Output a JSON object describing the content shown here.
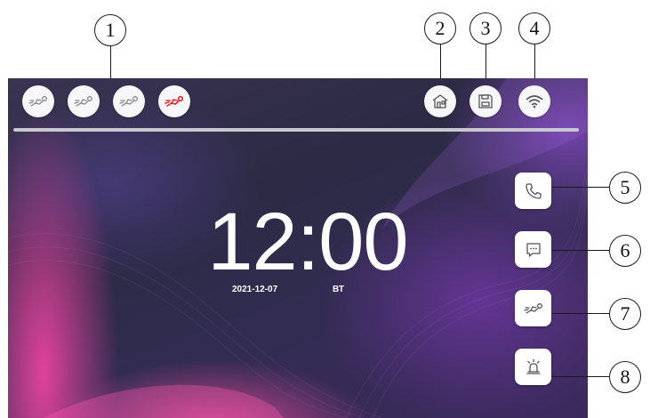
{
  "callouts": [
    "1",
    "2",
    "3",
    "4",
    "5",
    "6",
    "7",
    "8"
  ],
  "clock": {
    "time": "12:00",
    "date": "2021-12-07",
    "day": "ВТ"
  },
  "status_icons": [
    {
      "name": "intruder-icon",
      "state": "inactive",
      "color": "#888888"
    },
    {
      "name": "intruder-icon",
      "state": "inactive",
      "color": "#888888"
    },
    {
      "name": "intruder-icon",
      "state": "inactive",
      "color": "#888888"
    },
    {
      "name": "intruder-icon",
      "state": "alarm",
      "color": "#e3282e"
    }
  ],
  "top_right_icons": [
    "home-icon",
    "floppy-disk-icon",
    "wifi-icon"
  ],
  "side_buttons": [
    "phone-icon",
    "message-icon",
    "intruder-icon",
    "alarm-siren-icon"
  ],
  "colors": {
    "alarm": "#e3282e",
    "icon": "#555555"
  }
}
